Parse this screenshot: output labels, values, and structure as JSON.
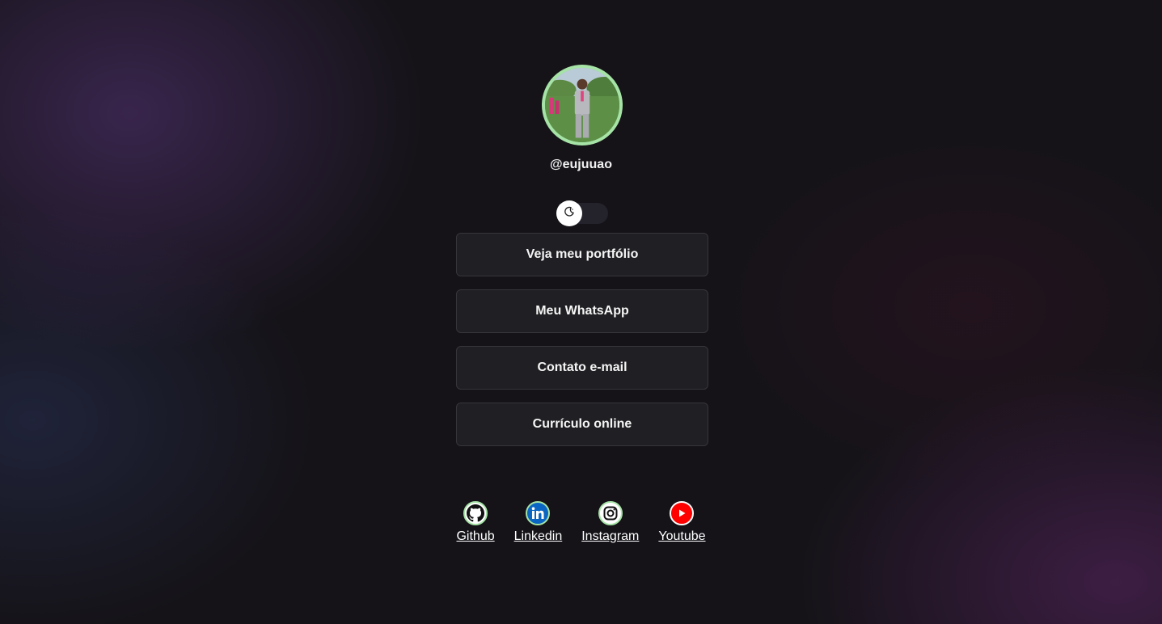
{
  "profile": {
    "username": "@eujuuao",
    "avatar_icon": "profile-photo"
  },
  "theme_toggle": {
    "icon": "moon-icon",
    "state": "dark"
  },
  "links": [
    {
      "label": "Veja meu portfólio"
    },
    {
      "label": "Meu WhatsApp"
    },
    {
      "label": "Contato e-mail"
    },
    {
      "label": "Currículo online"
    }
  ],
  "socials": [
    {
      "label": "Github",
      "icon": "github-icon",
      "color": "#ffffff"
    },
    {
      "label": "Linkedin",
      "icon": "linkedin-icon",
      "color": "#0a66c2"
    },
    {
      "label": "Instagram",
      "icon": "instagram-icon",
      "color": "#ffffff"
    },
    {
      "label": "Youtube",
      "icon": "youtube-icon",
      "color": "#ff0000"
    }
  ],
  "colors": {
    "avatar_border": "#a6e3a6",
    "background": "#151318"
  }
}
